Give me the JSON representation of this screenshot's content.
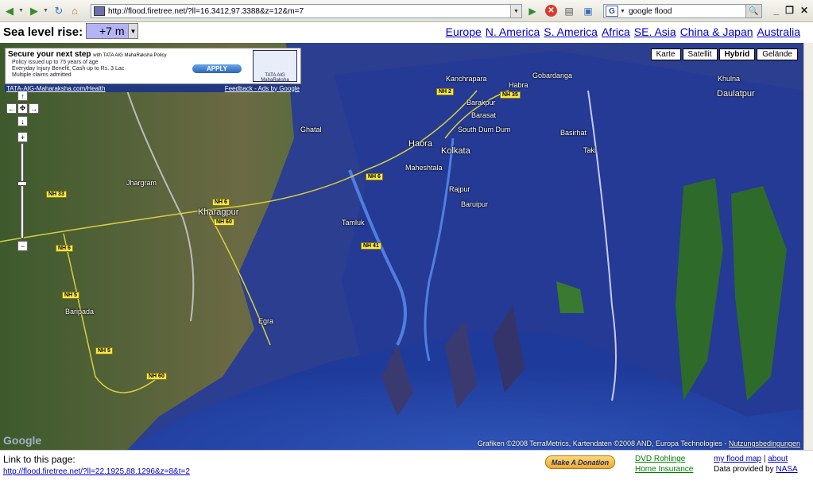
{
  "browser": {
    "url": "http://flood.firetree.net/?ll=16.3412,97.3388&z=12&m=7",
    "search_text": "google flood",
    "search_engine_letter": "G"
  },
  "header": {
    "sea_label": "Sea level rise:",
    "sea_value": "+7 m",
    "regions": [
      "Europe",
      "N. America",
      "S. America",
      "Africa",
      "SE. Asia",
      "China & Japan",
      "Australia"
    ]
  },
  "map": {
    "types": [
      "Karte",
      "Satellit",
      "Hybrid",
      "Gelände"
    ],
    "active_type": "Hybrid",
    "ad": {
      "title": "Secure your next step",
      "title_suffix": "with TATA AIG MahaRaksha Policy",
      "lines": [
        "Policy issued up to 75 years of age",
        "Everyday Injury Benefit, Cash up to Rs. 3 Lac",
        "Multiple claims admitted"
      ],
      "apply": "APPLY",
      "logo_text": "TATA AIG MahaRaksha",
      "footer_left": "TATA-AIG-Maharaksha.com/Health",
      "footer_right": "Feedback - Ads by Google"
    },
    "cities": {
      "kolkata": "Kolkata",
      "haora": "Haora",
      "maheshtala": "Maheshtala",
      "south_dum_dum": "South Dum Dum",
      "barakpur": "Barakpur",
      "kanchrapara": "Kanchrapara",
      "habra": "Habra",
      "gobardanga": "Gobardanga",
      "barasat": "Barasat",
      "basirhat": "Basirhat",
      "taki": "Taki",
      "khulna": "Khulna",
      "daulatpur": "Daulatpur",
      "ghatal": "Ghatal",
      "jhargram": "Jhargram",
      "kharagpur": "Kharagpur",
      "tamluk": "Tamluk",
      "rajpur": "Rajpur",
      "baruipur": "Baruipur",
      "baripada": "Baripada",
      "egra": "Egra"
    },
    "roads": {
      "nh2": "NH 2",
      "nh35": "NH 35",
      "nh33": "NH 33",
      "nh6a": "NH 6",
      "nh6b": "NH 6",
      "nh6c": "NH 6",
      "nh60": "NH 60",
      "nh5a": "NH 5",
      "nh5b": "NH 5",
      "nh41": "NH 41",
      "nh60b": "NH 60"
    },
    "copyright": "Grafiken ©2008 TerraMetrics, Kartendaten ©2008 AND, Europa Technologies -",
    "terms": "Nutzungsbedingungen",
    "google": "Google"
  },
  "footer": {
    "link_label": "Link to this page:",
    "link_url": "http://flood.firetree.net/?ll=22.1925,88.1296&z=8&t=2",
    "donate": "Make A Donation",
    "ad_link1": "DVD Rohlinge",
    "ad_link2": "Home Insurance",
    "my_flood_map": "my flood map",
    "separator": "|",
    "about": "about",
    "data_by": "Data provided by",
    "nasa": "NASA"
  }
}
